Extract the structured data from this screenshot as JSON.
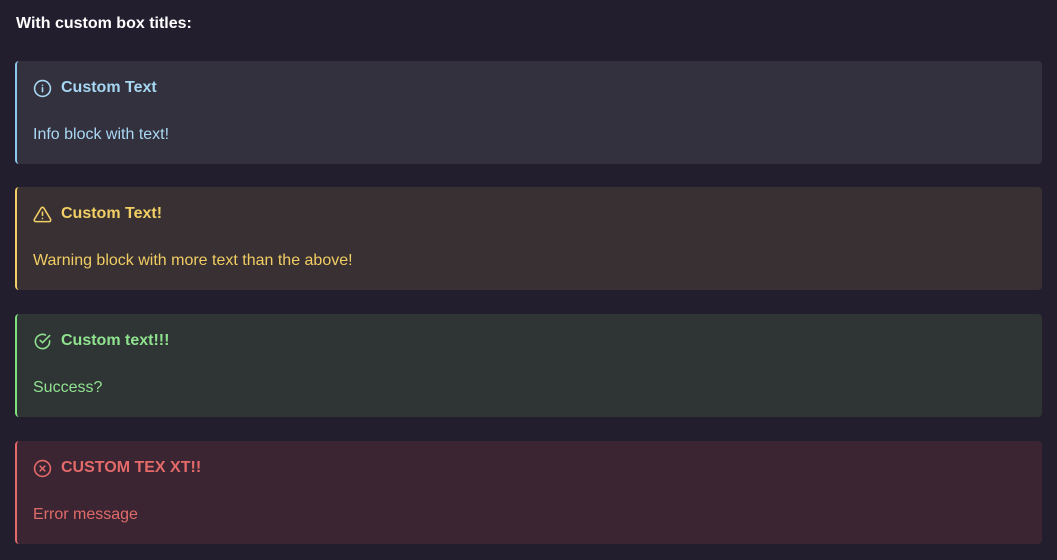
{
  "heading": "With custom box titles:",
  "callouts": [
    {
      "type": "info",
      "icon": "info-circle-icon",
      "title": "Custom Text",
      "body": "Info block with text!",
      "color": "#8cc8ec"
    },
    {
      "type": "warning",
      "icon": "warning-triangle-icon",
      "title": "Custom Text!",
      "body": "Warning block with more text than the above!",
      "color": "#f2cf65"
    },
    {
      "type": "success",
      "icon": "check-circle-icon",
      "title": "Custom text!!!",
      "body": "Success?",
      "color": "#7fe07f"
    },
    {
      "type": "error",
      "icon": "x-circle-icon",
      "title": "CUSTOM TEX XT!!",
      "body": "Error message",
      "color": "#e46a6a"
    }
  ]
}
